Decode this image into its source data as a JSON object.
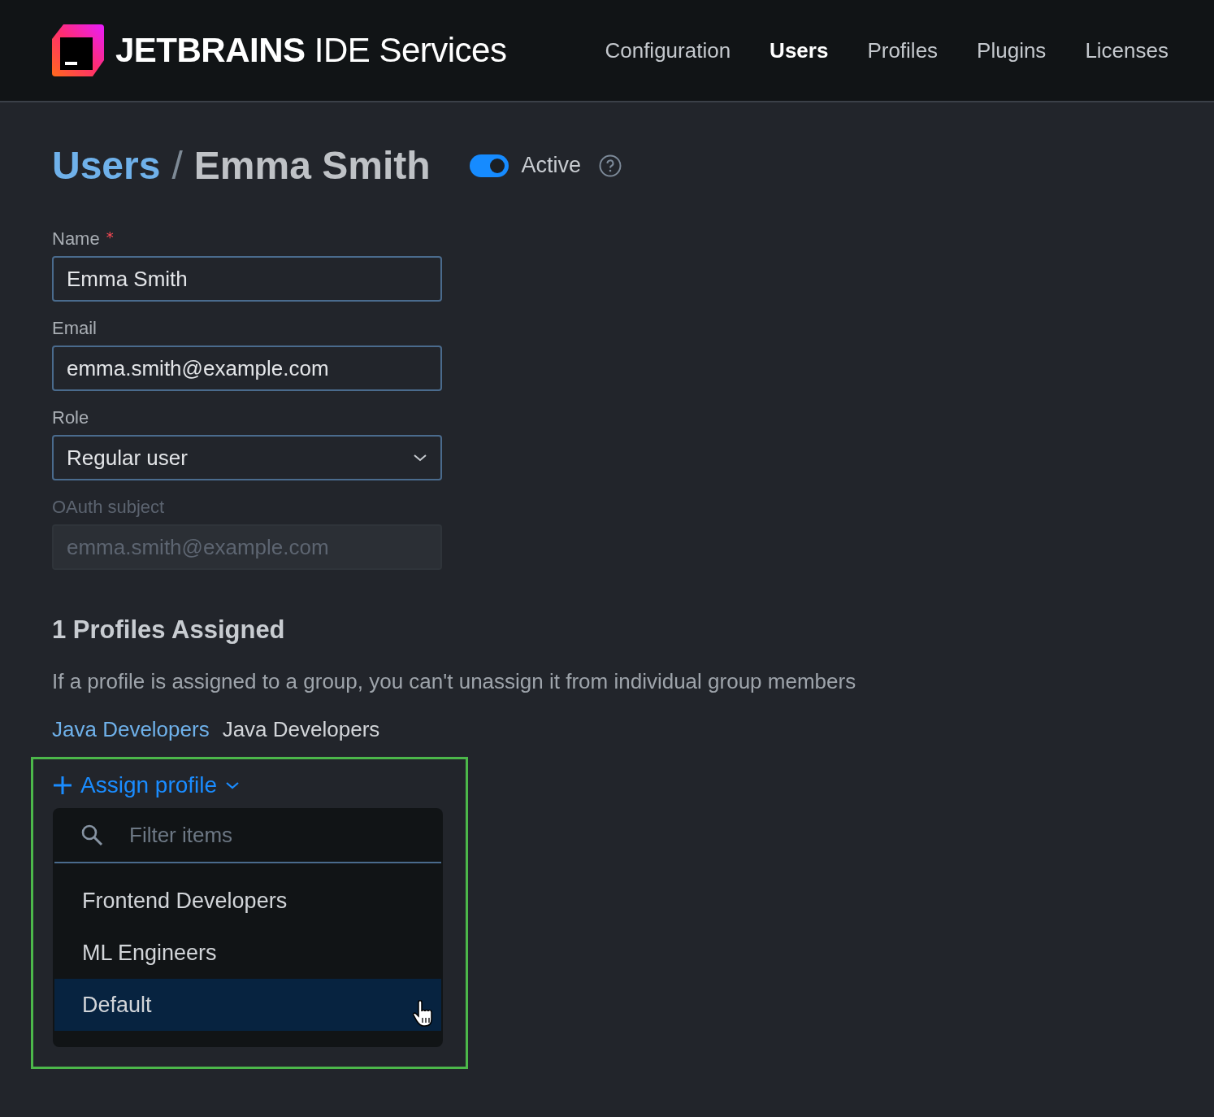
{
  "header": {
    "brand_bold": "JETBRAINS",
    "brand_rest": "IDE Services",
    "nav": [
      {
        "label": "Configuration",
        "selected": false
      },
      {
        "label": "Users",
        "selected": true
      },
      {
        "label": "Profiles",
        "selected": false
      },
      {
        "label": "Plugins",
        "selected": false
      },
      {
        "label": "Licenses",
        "selected": false
      }
    ]
  },
  "breadcrumb": {
    "parent": "Users",
    "separator": "/",
    "current": "Emma Smith"
  },
  "status_toggle": {
    "label": "Active",
    "on": true
  },
  "fields": [
    {
      "kind": "text",
      "label": "Name",
      "required_mark": "*",
      "value": "Emma Smith",
      "disabled": false
    },
    {
      "kind": "text",
      "label": "Email",
      "value": "emma.smith@example.com",
      "disabled": false
    },
    {
      "kind": "select",
      "label": "Role",
      "value": "Regular user"
    },
    {
      "kind": "text",
      "label": "OAuth subject",
      "value": "emma.smith@example.com",
      "disabled": true
    }
  ],
  "profiles": {
    "heading": "1 Profiles Assigned",
    "note": "If a profile is assigned to a group, you can't unassign it from individual group members",
    "assigned": [
      {
        "link": "Java Developers",
        "name": "Java Developers"
      }
    ]
  },
  "assign": {
    "label": "Assign profile",
    "expanded": true,
    "filter_placeholder": "Filter items",
    "items": [
      {
        "label": "Frontend Developers",
        "selected": false
      },
      {
        "label": "ML Engineers",
        "selected": false
      },
      {
        "label": "Default",
        "selected": true
      }
    ]
  }
}
